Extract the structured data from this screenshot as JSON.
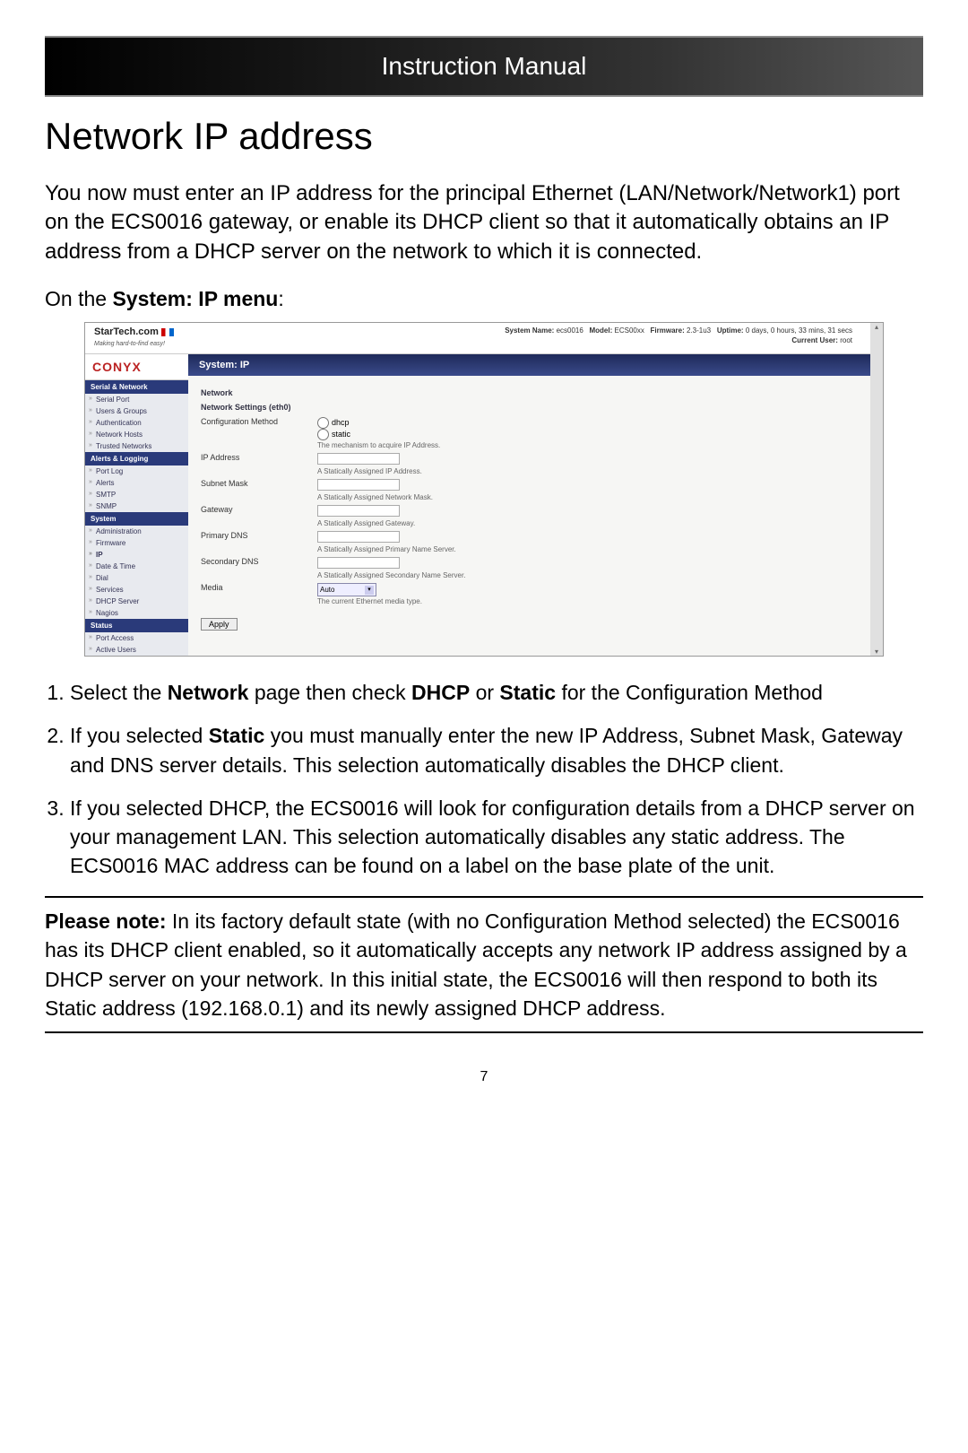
{
  "header": {
    "title": "Instruction Manual"
  },
  "section": {
    "title": "Network IP address"
  },
  "intro": "You now must enter an IP address for the principal Ethernet (LAN/Network/Network1) port on the ECS0016 gateway, or enable its DHCP client so that it automatically obtains an IP address from a DHCP server on the network to which it is connected.",
  "on_menu_prefix": "On the ",
  "on_menu_bold": "System: IP menu",
  "on_menu_suffix": ":",
  "screenshot": {
    "logo_text": "StarTech.com",
    "logo_sub": "Making hard-to-find easy!",
    "sysinfo_line1_a": "System Name:",
    "sysinfo_line1_b": "ecs0016",
    "sysinfo_line1_c": "Model:",
    "sysinfo_line1_d": "ECS00xx",
    "sysinfo_line1_e": "Firmware:",
    "sysinfo_line1_f": "2.3-1u3",
    "sysinfo_line1_g": "Uptime:",
    "sysinfo_line1_h": "0 days, 0 hours, 33 mins, 31 secs",
    "sysinfo_line2_a": "Current User:",
    "sysinfo_line2_b": "root",
    "brand": "CONYX",
    "titlebar": "System: IP",
    "nav": {
      "h1": "Serial & Network",
      "i1": "Serial Port",
      "i2": "Users & Groups",
      "i3": "Authentication",
      "i4": "Network Hosts",
      "i5": "Trusted Networks",
      "h2": "Alerts & Logging",
      "i6": "Port Log",
      "i7": "Alerts",
      "i8": "SMTP",
      "i9": "SNMP",
      "h3": "System",
      "i10": "Administration",
      "i11": "Firmware",
      "i12": "IP",
      "i13": "Date & Time",
      "i14": "Dial",
      "i15": "Services",
      "i16": "DHCP Server",
      "i17": "Nagios",
      "h4": "Status",
      "i18": "Port Access",
      "i19": "Active Users"
    },
    "content": {
      "network_h": "Network",
      "settings_h": "Network Settings (eth0)",
      "row1_label": "Configuration Method",
      "row1_opt1": "dhcp",
      "row1_opt2": "static",
      "row1_hint": "The mechanism to acquire IP Address.",
      "row2_label": "IP Address",
      "row2_hint": "A Statically Assigned IP Address.",
      "row3_label": "Subnet Mask",
      "row3_hint": "A Statically Assigned Network Mask.",
      "row4_label": "Gateway",
      "row4_hint": "A Statically Assigned Gateway.",
      "row5_label": "Primary DNS",
      "row5_hint": "A Statically Assigned Primary Name Server.",
      "row6_label": "Secondary DNS",
      "row6_hint": "A Statically Assigned Secondary Name Server.",
      "row7_label": "Media",
      "row7_select": "Auto",
      "row7_hint": "The current Ethernet media type.",
      "apply": "Apply"
    }
  },
  "steps": {
    "s1_a": "Select the ",
    "s1_b": "Network",
    "s1_c": " page then check ",
    "s1_d": "DHCP",
    "s1_e": " or ",
    "s1_f": "Static",
    "s1_g": " for the Configuration Method",
    "s2_a": "If you selected ",
    "s2_b": "Static",
    "s2_c": " you must manually enter the new IP Address, Subnet Mask, Gateway and DNS server details. This selection automatically disables the DHCP client.",
    "s3": "If you selected DHCP, the ECS0016 will look for configuration details from a DHCP server on your management LAN. This selection automatically disables any static address. The ECS0016 MAC address can be found on a label on the base plate of the unit."
  },
  "note": {
    "label": "Please note:",
    "text": " In its factory default state (with no Configuration Method selected) the ECS0016 has its DHCP client enabled, so it automatically accepts any network IP address assigned by a DHCP server on your network. In this initial state, the ECS0016 will then respond to both its Static address (192.168.0.1) and its newly assigned DHCP address."
  },
  "page_number": "7"
}
